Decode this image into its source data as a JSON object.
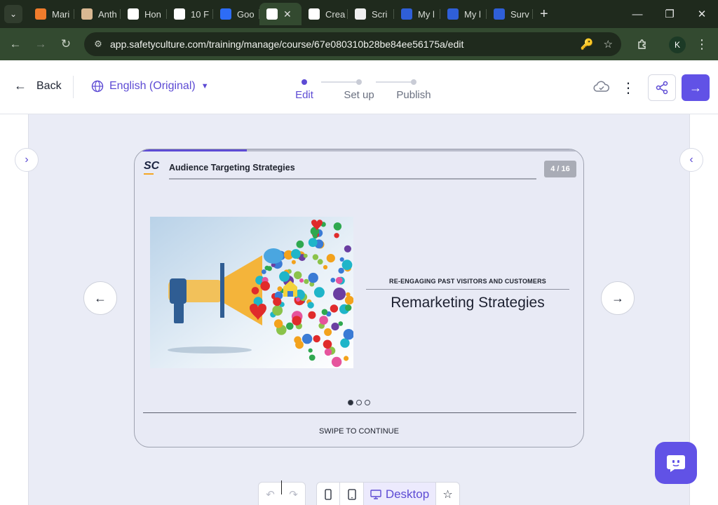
{
  "browser": {
    "tabs": [
      {
        "label": "Mari",
        "favicon": "orange-bars-icon",
        "color": "#f07c2c"
      },
      {
        "label": "Anth",
        "favicon": "anthropic-icon",
        "color": "#d9b892"
      },
      {
        "label": "Hon",
        "favicon": "notion-icon",
        "color": "#ffffff"
      },
      {
        "label": "10 F",
        "favicon": "sc-icon",
        "color": "#ffffff"
      },
      {
        "label": "Goo",
        "favicon": "butterfly-icon",
        "color": "#2d6cf6"
      },
      {
        "label": "",
        "favicon": "sc-icon",
        "color": "#ffffff",
        "active": true
      },
      {
        "label": "Crea",
        "favicon": "sc-icon",
        "color": "#ffffff"
      },
      {
        "label": "Scri",
        "favicon": "rainbow-icon",
        "color": "#f0f0f0"
      },
      {
        "label": "My l",
        "favicon": "video-icon",
        "color": "#2f5fd8"
      },
      {
        "label": "My l",
        "favicon": "video-icon",
        "color": "#2f5fd8"
      },
      {
        "label": "Surv",
        "favicon": "video-icon",
        "color": "#2f5fd8"
      }
    ],
    "url": "app.safetyculture.com/training/manage/course/67e080310b28be84ee56175a/edit",
    "profile_initial": "K"
  },
  "header": {
    "back_label": "Back",
    "language": "English (Original)",
    "steps": [
      {
        "label": "Edit",
        "active": true
      },
      {
        "label": "Set up",
        "active": false
      },
      {
        "label": "Publish",
        "active": false
      }
    ]
  },
  "slide": {
    "course_title": "Audience Targeting Strategies",
    "counter": "4 / 16",
    "progress": 0.25,
    "eyebrow": "RE-ENGAGING PAST VISITORS AND CUSTOMERS",
    "heading": "Remarketing Strategies",
    "pager": {
      "count": 3,
      "current": 1
    },
    "swipe_label": "SWIPE TO CONTINUE",
    "logo_text": "SC"
  },
  "toolbar": {
    "view_label": "Desktop"
  },
  "colors": {
    "accent": "#5d4bd4",
    "accent_button": "#6152e6",
    "stage_bg": "#eaecf6"
  }
}
